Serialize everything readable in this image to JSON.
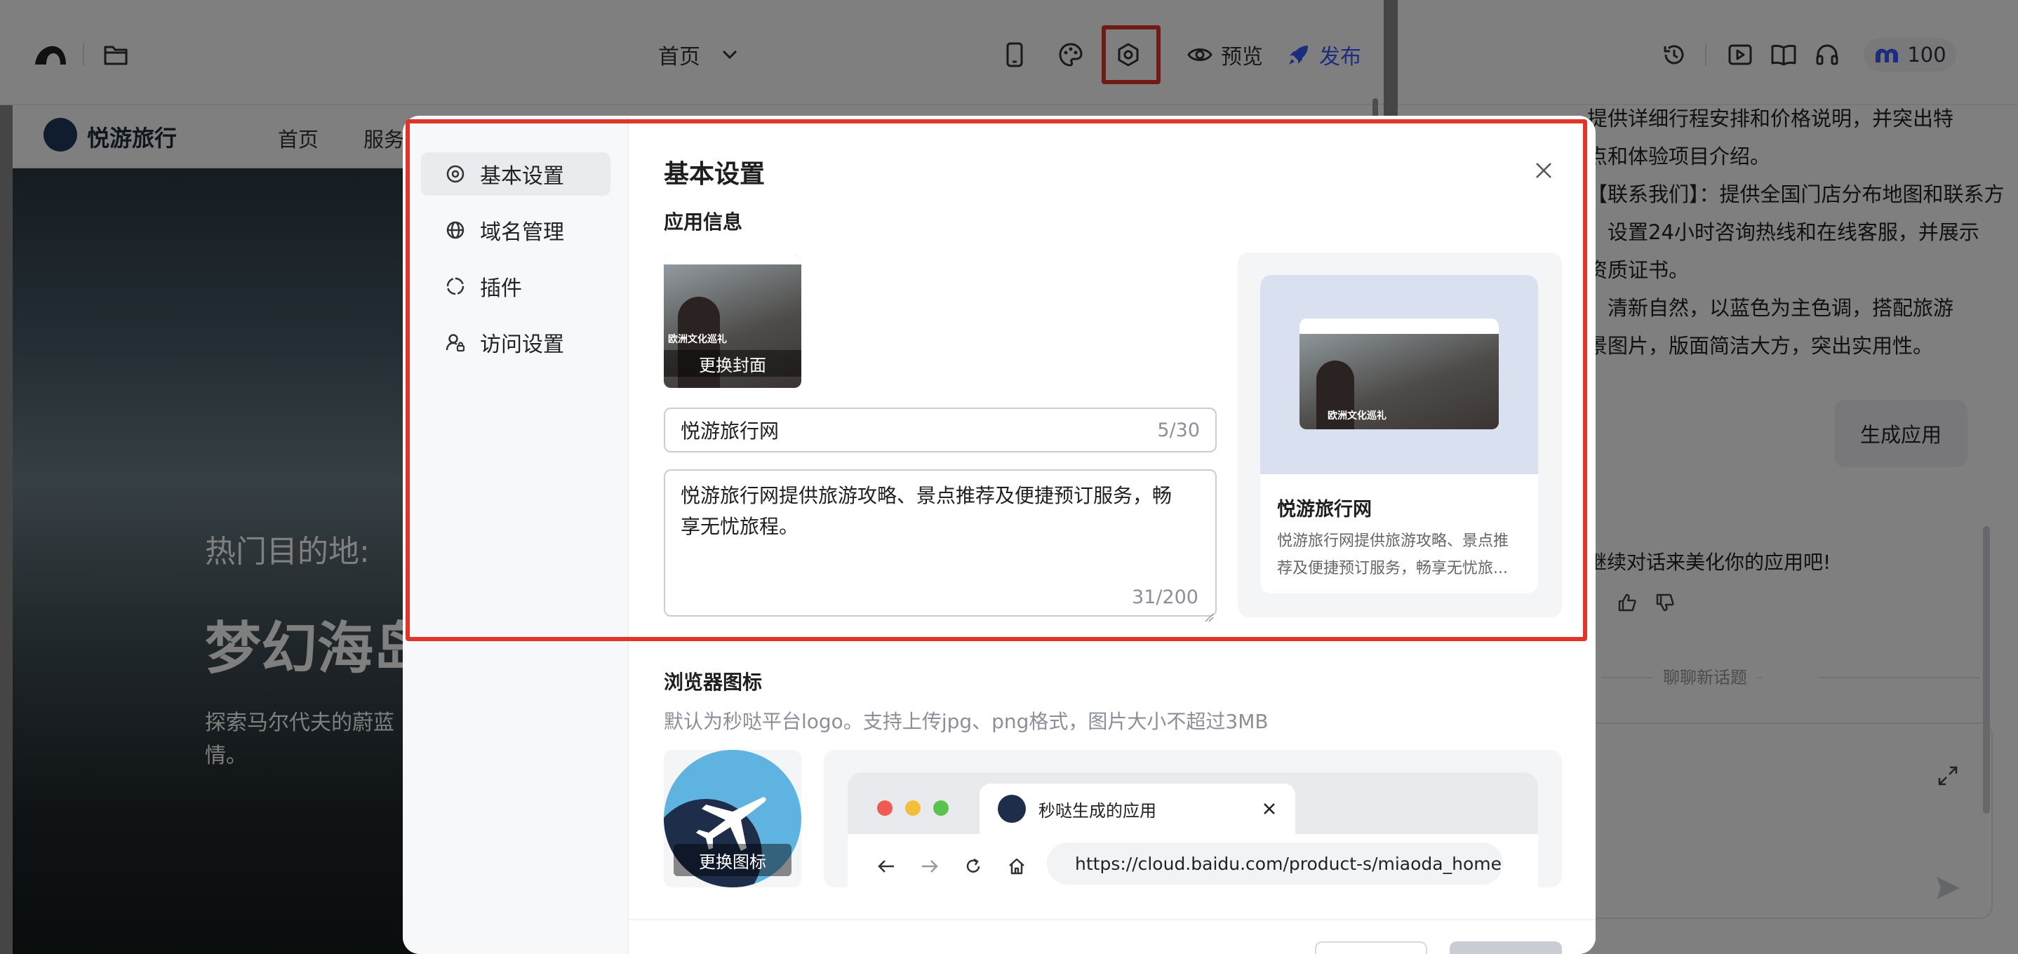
{
  "toolbar": {
    "page_select": "首页",
    "preview_label": "预览",
    "publish_label": "发布",
    "credits": "100",
    "brand_color": "#3b5bfd"
  },
  "site": {
    "brand": "悦游旅行",
    "nav_items": [
      "首页",
      "服务"
    ],
    "hero_kicker": "热门目的地:",
    "hero_title": "梦幻海岛",
    "hero_desc_line1": "探索马尔代夫的蔚蓝",
    "hero_desc_line2": "情。"
  },
  "chat": {
    "lines": [
      "提供详细行程安排和价格说明，并突出特",
      "点和体验项目介绍。",
      "【联系我们】：提供全国门店分布地图和联系方",
      "，设置24小时咨询热线和在线客服，并展示",
      "资质证书。",
      "：清新自然，以蓝色为主色调，搭配旅游",
      "景图片，版面简洁大方，突出实用性。"
    ],
    "generate_button": "生成应用",
    "continue_text": "继续对话来美化你的应用吧!",
    "new_topic": "聊聊新话题"
  },
  "modal": {
    "title": "基本设置",
    "sidebar": [
      {
        "label": "基本设置",
        "icon": "settings-circle-icon"
      },
      {
        "label": "域名管理",
        "icon": "globe-icon"
      },
      {
        "label": "插件",
        "icon": "plugin-icon"
      },
      {
        "label": "访问设置",
        "icon": "user-access-icon"
      }
    ],
    "app_info": {
      "section_title": "应用信息",
      "cover_caption": "欧洲文化巡礼",
      "change_cover": "更换封面",
      "name_value": "悦游旅行网",
      "name_counter": "5/30",
      "desc_value": "悦游旅行网提供旅游攻略、景点推荐及便捷预订服务，畅享无忧旅程。",
      "desc_counter": "31/200",
      "card_title": "悦游旅行网",
      "card_desc": "悦游旅行网提供旅游攻略、景点推荐及便捷预订服务，畅享无忧旅..."
    },
    "favicon": {
      "section_title": "浏览器图标",
      "hint": "默认为秒哒平台logo。支持上传jpg、png格式，图片大小不超过3MB",
      "change_icon": "更换图标",
      "tab_title": "秒哒生成的应用",
      "url": "https://cloud.baidu.com/product-s/miaoda_home"
    }
  }
}
